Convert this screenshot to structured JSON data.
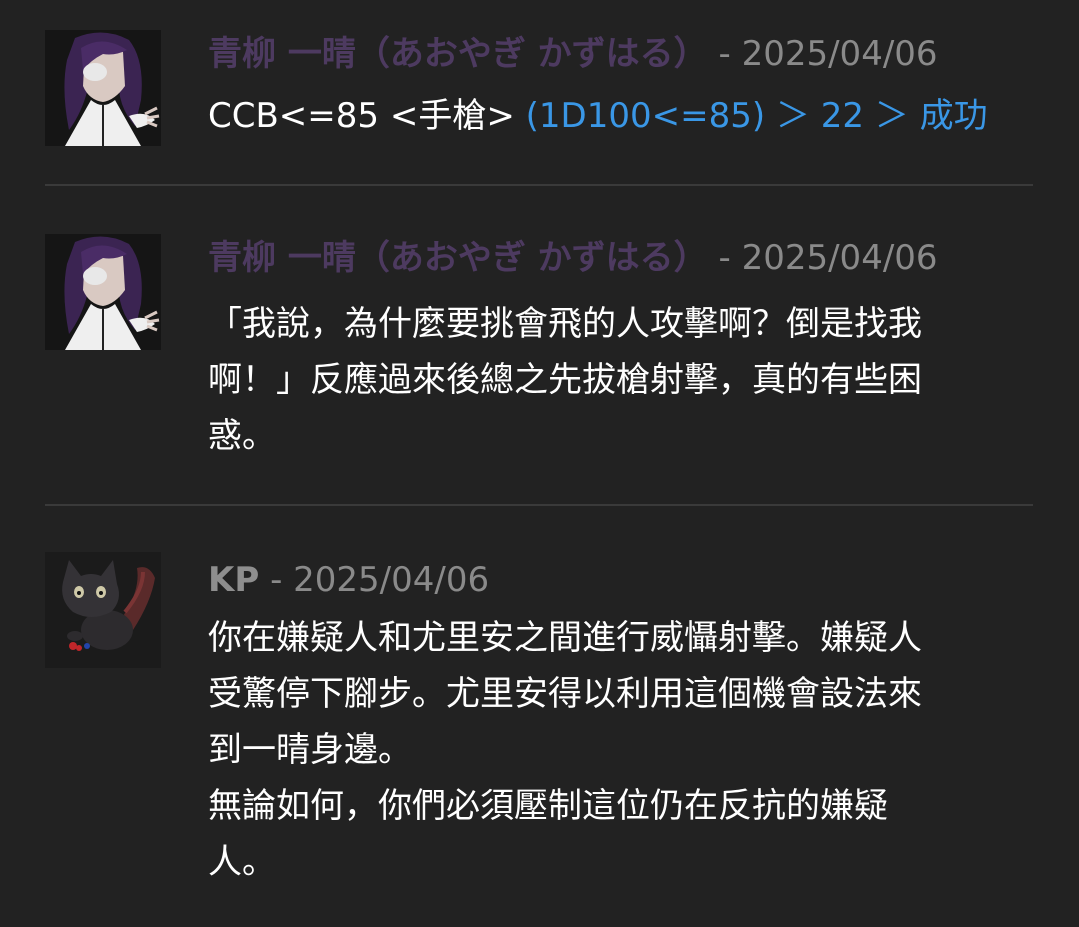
{
  "messages": [
    {
      "author": "青柳 一晴（あおやぎ かずはる）",
      "date": "- 2025/04/06",
      "command": "CCB<=85 <手槍> ",
      "result": "(1D100<=85) ＞ 22 ＞ 成功"
    },
    {
      "author": "青柳 一晴（あおやぎ かずはる）",
      "date": "- 2025/04/06",
      "text": "「我說，為什麼要挑會飛的人攻擊啊？倒是找我\n啊！」反應過來後總之先拔槍射擊，真的有些困\n惑。"
    },
    {
      "author": "KP",
      "date": "- 2025/04/06",
      "text": "你在嫌疑人和尤里安之間進行威懾射擊。嫌疑人\n受驚停下腳步。尤里安得以利用這個機會設法來\n到一晴身邊。\n無論如何，你們必須壓制這位仍在反抗的嫌疑\n人。"
    }
  ],
  "colors": {
    "background": "#222222",
    "author_purple": "#4d3a60",
    "author_grey": "#8e8e8e",
    "date": "#8a8a8a",
    "dice_result": "#3a97e6",
    "divider": "#3a3a3a"
  },
  "icons": {
    "avatar_1": "purple-haired-character-avatar",
    "avatar_2": "purple-haired-character-avatar",
    "avatar_3": "black-cat-avatar"
  }
}
